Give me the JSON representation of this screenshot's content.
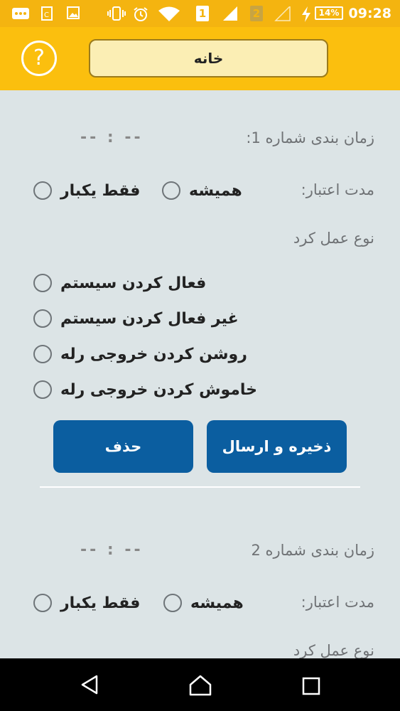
{
  "status_bar": {
    "time": "09:28",
    "battery": "14%",
    "sim1": "1",
    "sim2": "2"
  },
  "header": {
    "title": "خانه",
    "help_icon": "?"
  },
  "schedule1": {
    "title": "زمان بندی شماره 1:",
    "time_value": "-- : --",
    "validity_label": "مدت اعتبار:",
    "always_label": "همیشه",
    "once_label": "فقط یکبار",
    "action_type_label": "نوع عمل کرد",
    "actions": [
      "فعال کردن سیستم",
      "غیر فعال کردن سیستم",
      "روشن کردن خروجی رله",
      "خاموش کردن خروجی رله"
    ],
    "save_button": "ذخیره و ارسال",
    "delete_button": "حذف"
  },
  "schedule2": {
    "title": "زمان بندی شماره 2",
    "time_value": "-- : --",
    "validity_label": "مدت اعتبار:",
    "always_label": "همیشه",
    "once_label": "فقط یکبار",
    "action_type_label": "نوع عمل کرد"
  },
  "colors": {
    "header": "#fbbf0e",
    "button": "#0b5ea0",
    "background": "#dce4e6"
  }
}
